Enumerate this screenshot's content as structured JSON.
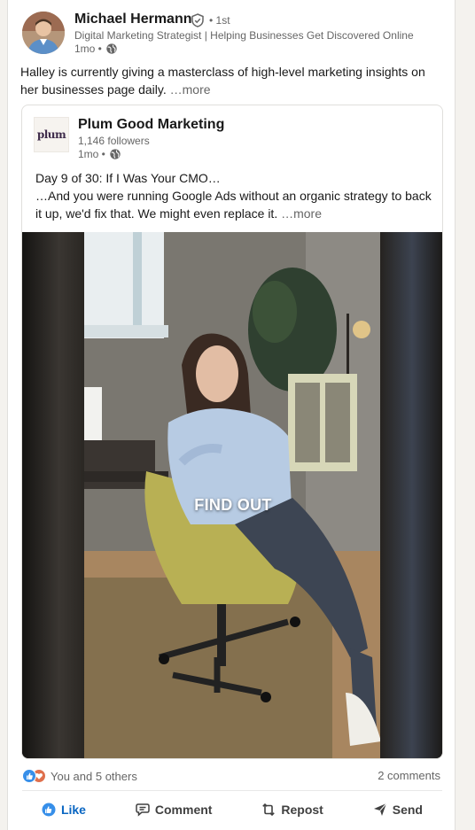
{
  "author": {
    "name": "Michael Hermann",
    "degree": "• 1st",
    "headline": "Digital Marketing Strategist | Helping Businesses Get Discovered Online",
    "time": "1mo •"
  },
  "post": {
    "text": "Halley is currently giving a masterclass of high-level marketing insights on her businesses page daily.",
    "more": "…more"
  },
  "shared": {
    "org_logo_text": "plum",
    "org_name": "Plum Good Marketing",
    "followers": "1,146 followers",
    "time": "1mo •",
    "line1": "Day 9 of 30: If I Was Your CMO…",
    "line2": "…And you were running Google Ads without an organic strategy to back it up, we'd fix that. We might even replace it.",
    "more": "…more",
    "video_overlay": "FIND OUT"
  },
  "social": {
    "reactions_text": "You and 5 others",
    "comments_text": "2 comments"
  },
  "actions": {
    "like": "Like",
    "comment": "Comment",
    "repost": "Repost",
    "send": "Send"
  },
  "colors": {
    "link_blue": "#0a66c2",
    "like_icon": "#378fe9",
    "heart_icon": "#df704d"
  },
  "icons": [
    "verified-shield-icon",
    "globe-icon",
    "like-reaction-icon",
    "love-reaction-icon",
    "thumbs-up-icon",
    "comment-icon",
    "repost-icon",
    "send-icon"
  ]
}
